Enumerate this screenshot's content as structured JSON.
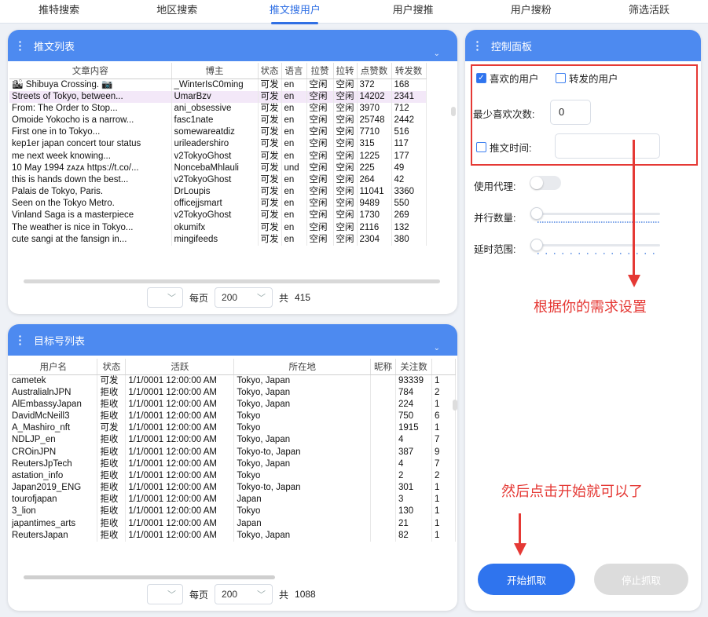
{
  "tabs": [
    "推特搜索",
    "地区搜索",
    "推文搜用户",
    "用户搜推",
    "用户搜粉",
    "筛选活跃"
  ],
  "active_tab": 2,
  "tweet_panel": {
    "title": "推文列表",
    "columns": [
      "文章内容",
      "博主",
      "状态",
      "语言",
      "拉赞",
      "拉转",
      "点赞数",
      "转发数"
    ],
    "rows": [
      [
        "🏙 Shibuya Crossing. 📷",
        "_WinterIsC0ming",
        "可发",
        "en",
        "空闲",
        "空闲",
        "372",
        "168"
      ],
      [
        "Streets of Tokyo, between...",
        "UmarBzv",
        "可发",
        "en",
        "空闲",
        "空闲",
        "14202",
        "2341"
      ],
      [
        "From: The Order to Stop...",
        "ani_obsessive",
        "可发",
        "en",
        "空闲",
        "空闲",
        "3970",
        "712"
      ],
      [
        "Omoide Yokocho is a narrow...",
        "fasc1nate",
        "可发",
        "en",
        "空闲",
        "空闲",
        "25748",
        "2442"
      ],
      [
        "First one in to Tokyo...",
        "somewareatdiz",
        "可发",
        "en",
        "空闲",
        "空闲",
        "7710",
        "516"
      ],
      [
        "kep1er japan concert tour status",
        "urileadershiro",
        "可发",
        "en",
        "空闲",
        "空闲",
        "315",
        "117"
      ],
      [
        "me next week knowing...",
        "v2TokyoGhost",
        "可发",
        "en",
        "空闲",
        "空闲",
        "1225",
        "177"
      ],
      [
        "10 May 1994 ᴢᴀᴢᴀ https://t.co/...",
        "NoncebaMhlauli",
        "可发",
        "und",
        "空闲",
        "空闲",
        "225",
        "49"
      ],
      [
        "this is hands down the best...",
        "v2TokyoGhost",
        "可发",
        "en",
        "空闲",
        "空闲",
        "264",
        "42"
      ],
      [
        "Palais de Tokyo, Paris.",
        "DrLoupis",
        "可发",
        "en",
        "空闲",
        "空闲",
        "11041",
        "3360"
      ],
      [
        "Seen on the Tokyo Metro.",
        "officejjsmart",
        "可发",
        "en",
        "空闲",
        "空闲",
        "9489",
        "550"
      ],
      [
        "Vinland Saga is a masterpiece",
        "v2TokyoGhost",
        "可发",
        "en",
        "空闲",
        "空闲",
        "1730",
        "269"
      ],
      [
        "The weather is nice in Tokyo...",
        "okumifx",
        "可发",
        "en",
        "空闲",
        "空闲",
        "2116",
        "132"
      ],
      [
        "cute sangi at the fansign in...",
        "mingifeeds",
        "可发",
        "en",
        "空闲",
        "空闲",
        "2304",
        "380"
      ]
    ],
    "selected_row": 1,
    "pager": {
      "per_page_label": "每页",
      "per_page": "200",
      "total_label": "共",
      "total": "415"
    }
  },
  "target_panel": {
    "title": "目标号列表",
    "columns": [
      "用户名",
      "状态",
      "活跃",
      "所在地",
      "昵称",
      "关注数",
      ""
    ],
    "rows": [
      [
        "cametek",
        "可发",
        "1/1/0001 12:00:00 AM",
        "Tokyo, Japan",
        "",
        "93339",
        "1"
      ],
      [
        "AustralialnJPN",
        "拒收",
        "1/1/0001 12:00:00 AM",
        "Tokyo, Japan",
        "",
        "784",
        "2"
      ],
      [
        "AlEmbassyJapan",
        "拒收",
        "1/1/0001 12:00:00 AM",
        "Tokyo, Japan",
        "",
        "224",
        "1"
      ],
      [
        "DavidMcNeill3",
        "拒收",
        "1/1/0001 12:00:00 AM",
        "Tokyo",
        "",
        "750",
        "6"
      ],
      [
        "A_Mashiro_nft",
        "可发",
        "1/1/0001 12:00:00 AM",
        "Tokyo",
        "",
        "1915",
        "1"
      ],
      [
        "NDLJP_en",
        "拒收",
        "1/1/0001 12:00:00 AM",
        "Tokyo, Japan",
        "",
        "4",
        "7"
      ],
      [
        "CROinJPN",
        "拒收",
        "1/1/0001 12:00:00 AM",
        "Tokyo-to, Japan",
        "",
        "387",
        "9"
      ],
      [
        "ReutersJpTech",
        "拒收",
        "1/1/0001 12:00:00 AM",
        "Tokyo, Japan",
        "",
        "4",
        "7"
      ],
      [
        "astation_info",
        "拒收",
        "1/1/0001 12:00:00 AM",
        "Tokyo",
        "",
        "2",
        "2"
      ],
      [
        "Japan2019_ENG",
        "拒收",
        "1/1/0001 12:00:00 AM",
        "Tokyo-to, Japan",
        "",
        "301",
        "1"
      ],
      [
        "tourofjapan",
        "拒收",
        "1/1/0001 12:00:00 AM",
        "Japan",
        "",
        "3",
        "1"
      ],
      [
        "3_lion",
        "拒收",
        "1/1/0001 12:00:00 AM",
        "Tokyo",
        "",
        "130",
        "1"
      ],
      [
        "japantimes_arts",
        "拒收",
        "1/1/0001 12:00:00 AM",
        "Japan",
        "",
        "21",
        "1"
      ],
      [
        "ReutersJapan",
        "拒收",
        "1/1/0001 12:00:00 AM",
        "Tokyo, Japan",
        "",
        "82",
        "1"
      ]
    ],
    "pager": {
      "per_page_label": "每页",
      "per_page": "200",
      "total_label": "共",
      "total": "1088"
    }
  },
  "control": {
    "title": "控制面板",
    "liked_users": "喜欢的用户",
    "liked_users_checked": true,
    "retweet_users": "转发的用户",
    "retweet_users_checked": false,
    "min_likes_label": "最少喜欢次数:",
    "min_likes_value": "0",
    "tweet_time_label": "推文时间:",
    "tweet_time_checked": false,
    "proxy_label": "使用代理:",
    "proxy_on": false,
    "parallel_label": "并行数量:",
    "delay_label": "延时范围:",
    "start_button": "开始抓取",
    "stop_button": "停止抓取"
  },
  "annotations": {
    "hint1": "根据你的需求设置",
    "hint2": "然后点击开始就可以了"
  },
  "colors": {
    "accent": "#4d8af0",
    "highlight": "#e53935",
    "start": "#2f74ee",
    "stop": "#dcdcdc"
  }
}
